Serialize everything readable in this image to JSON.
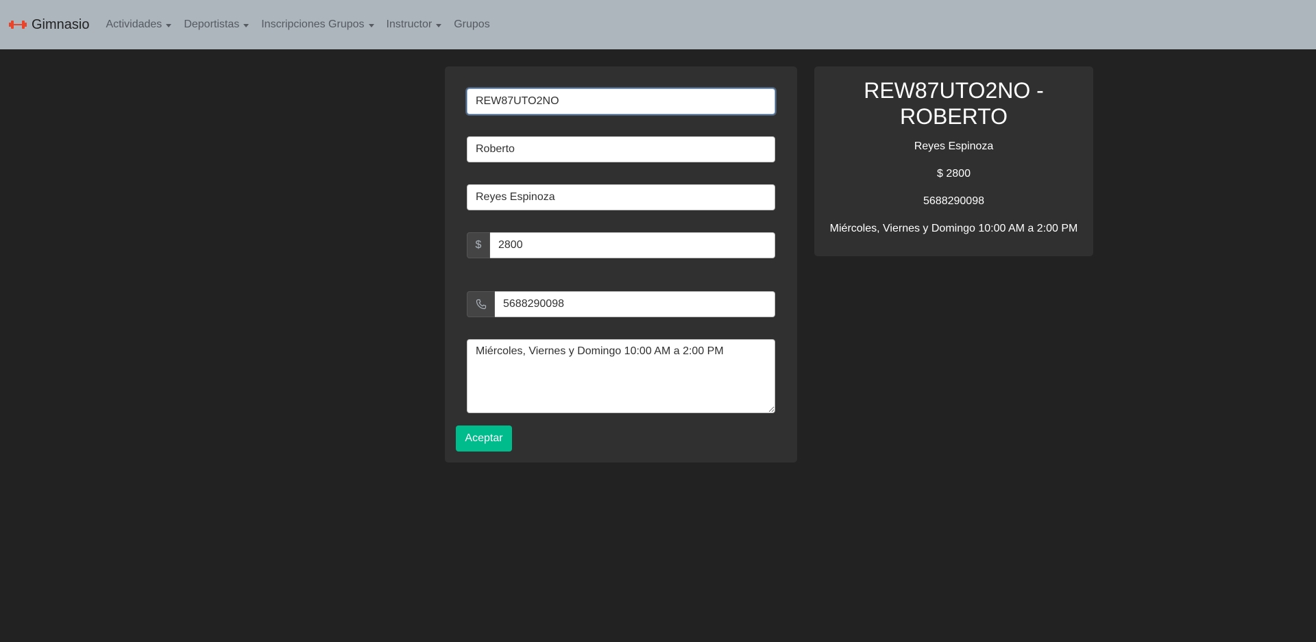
{
  "navbar": {
    "brand_icon": "dumbbell-icon",
    "brand_label": "Gimnasio",
    "items": [
      {
        "label": "Actividades",
        "dropdown": true
      },
      {
        "label": "Deportistas",
        "dropdown": true
      },
      {
        "label": "Inscripciones Grupos",
        "dropdown": true
      },
      {
        "label": "Instructor",
        "dropdown": true
      },
      {
        "label": "Grupos",
        "dropdown": false
      }
    ]
  },
  "form": {
    "code_value": "REW87UTO2NO",
    "name_value": "Roberto",
    "surname_value": "Reyes Espinoza",
    "price_addon": "$",
    "price_value": "2800",
    "phone_icon": "phone-icon",
    "phone_value": "5688290098",
    "schedule_value": "Miércoles, Viernes y Domingo 10:00 AM a 2:00 PM",
    "submit_label": "Aceptar"
  },
  "preview": {
    "title": "REW87UTO2NO - ROBERTO",
    "surname": "Reyes Espinoza",
    "price": "$ 2800",
    "phone": "5688290098",
    "schedule": "Miércoles, Viernes y Domingo 10:00 AM a 2:00 PM"
  },
  "colors": {
    "navbar_bg": "#adb5bd",
    "page_bg": "#222222",
    "card_bg": "#303030",
    "accent": "#00bc8c"
  }
}
